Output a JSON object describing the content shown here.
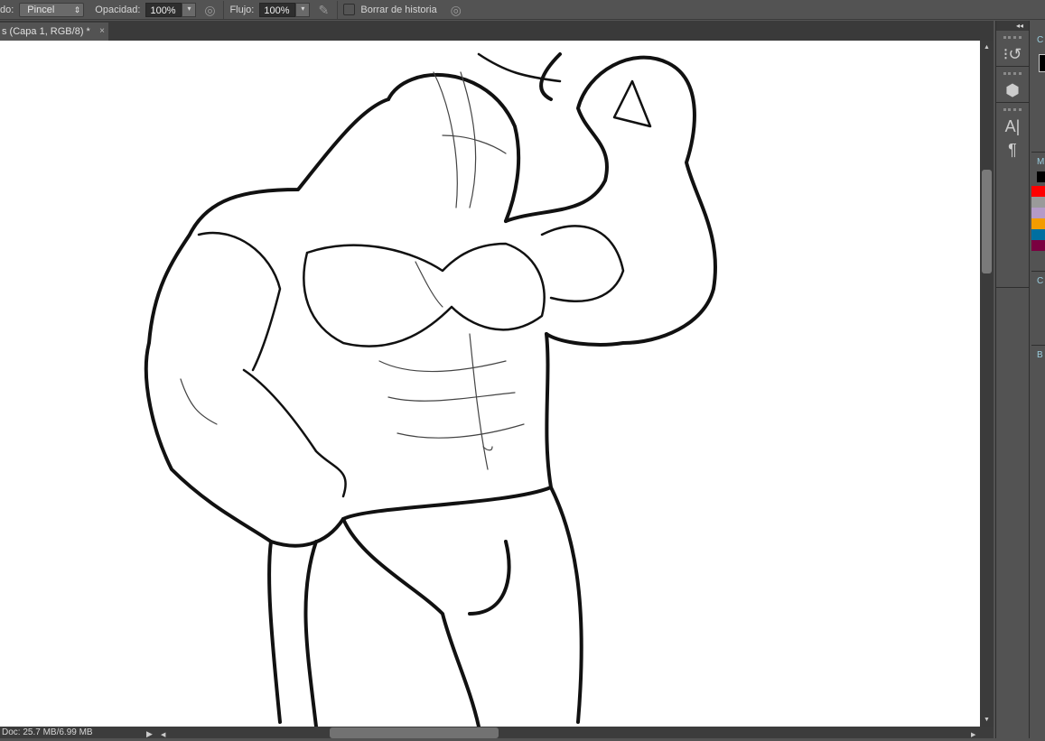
{
  "options_bar": {
    "mode_label": "do:",
    "mode_value": "Pincel",
    "opacity_label": "Opacidad:",
    "opacity_value": "100%",
    "flow_label": "Flujo:",
    "flow_value": "100%",
    "erase_history_label": "Borrar de historia",
    "erase_history_checked": false
  },
  "document_tab": {
    "title": "s (Capa 1, RGB/8) *",
    "close": "×"
  },
  "status": {
    "doc_info": "Doc: 25.7 MB/6.99 MB"
  },
  "panel_strip": {
    "collapse": "◂◂",
    "icons": [
      "history-icon",
      "properties-icon",
      "character-icon",
      "paragraph-icon"
    ],
    "char_glyph": "A|",
    "para_glyph": "¶"
  },
  "panels": {
    "headers": [
      "C",
      "M",
      "C",
      "B"
    ],
    "swatches": [
      "#ff0000",
      "#9a9a9a",
      "#b49ac8",
      "#f39c00",
      "#006fa0",
      "#7a0040"
    ]
  }
}
